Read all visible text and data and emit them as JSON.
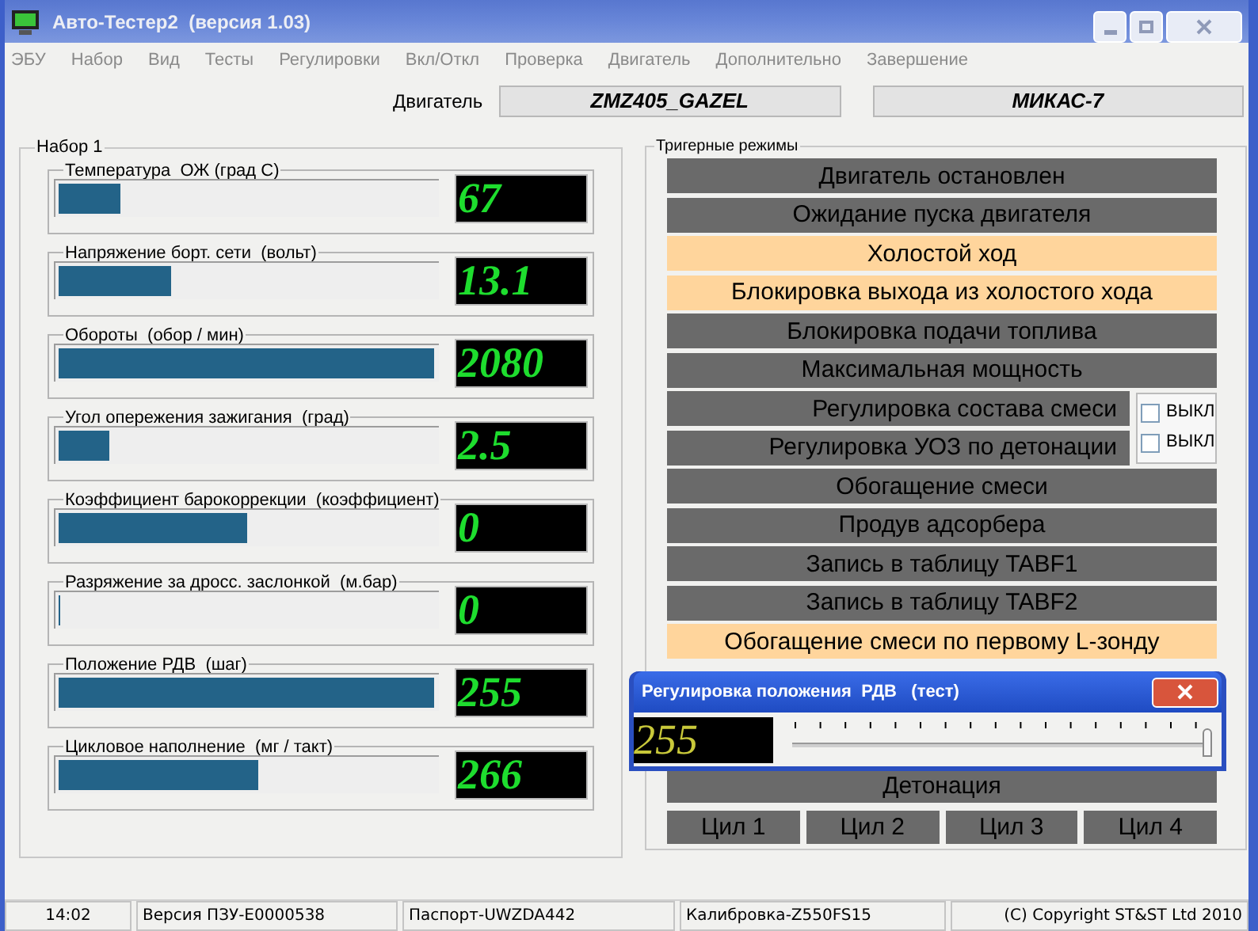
{
  "window": {
    "title": "Авто-Тестер2  (версия 1.03)"
  },
  "menu": [
    {
      "label": "ЭБУ",
      "disabled": true
    },
    {
      "label": "Набор",
      "disabled": true
    },
    {
      "label": "Вид",
      "disabled": true
    },
    {
      "label": "Тесты",
      "disabled": true
    },
    {
      "label": "Регулировки",
      "disabled": true
    },
    {
      "label": "Вкл/Откл",
      "disabled": true
    },
    {
      "label": "Проверка",
      "disabled": true
    },
    {
      "label": "Двигатель",
      "disabled": true
    },
    {
      "label": "Дополнительно",
      "disabled": true
    },
    {
      "label": "Завершение",
      "disabled": true
    }
  ],
  "engine": {
    "label": "Двигатель",
    "fields": [
      "ZMZ405_GAZEL",
      "МИКАС-7"
    ]
  },
  "parameters": {
    "title": "Набор 1",
    "gauges": [
      {
        "label": "Температура  ОЖ (град С)",
        "level": 0.165,
        "value": "67"
      },
      {
        "label": "Напряжение борт. сети  (вольт)",
        "level": 0.3,
        "value": "13.1"
      },
      {
        "label": "Обороты  (обор / мин)",
        "level": 0.995,
        "value": "2080"
      },
      {
        "label": "Угол опережения зажигания  (град)",
        "level": 0.136,
        "value": "2.5"
      },
      {
        "label": "Коэффициент барокоррекции  (коэффициент)",
        "level": 0.5,
        "value": "0"
      },
      {
        "label": "Разряжение за дросс. заслонкой  (м.бар)",
        "level": 0,
        "value": "0"
      },
      {
        "label": "Положение РДВ  (шаг)",
        "level": 0.995,
        "value": "255"
      },
      {
        "label": "Цикловое наполнение  (мг / такт)",
        "level": 0.53,
        "value": "266"
      }
    ]
  },
  "triggers": {
    "title": "Тригерные режимы",
    "modes": [
      {
        "label": "Двигатель остановлен",
        "active": false
      },
      {
        "label": "Ожидание пуска двигателя",
        "active": false
      },
      {
        "label": "Холостой ход",
        "active": true
      },
      {
        "label": "Блокировка выхода из холостого хода",
        "active": true
      },
      {
        "label": "Блокировка подачи топлива",
        "active": false
      },
      {
        "label": "Максимальная мощность",
        "active": false
      },
      {
        "label": "Регулировка состава смеси",
        "active": false,
        "checkbox": {
          "label": "ВЫКЛ",
          "checked": false
        }
      },
      {
        "label": "Регулировка УОЗ по детонации",
        "active": false,
        "checkbox": {
          "label": "ВЫКЛ",
          "checked": false
        }
      },
      {
        "label": "Обогащение смеси",
        "active": false
      },
      {
        "label": "Продув адсорбера",
        "active": false
      },
      {
        "label": "Запись в таблицу TABF1",
        "active": false
      },
      {
        "label": "Запись в таблицу TABF2",
        "active": false
      },
      {
        "label": "Обогащение смеси по первому L-зонду",
        "active": true
      }
    ],
    "lower_modes": [
      {
        "label": "Детонация",
        "active": false
      }
    ],
    "cylinders": [
      {
        "label": "Цил 1",
        "active": false
      },
      {
        "label": "Цил 2",
        "active": false
      },
      {
        "label": "Цил 3",
        "active": false
      },
      {
        "label": "Цил 4",
        "active": false
      }
    ]
  },
  "dialog": {
    "title": "Регулировка положения  РДВ   (тест)",
    "value": "255",
    "slider": {
      "level": 1
    }
  },
  "status_bar": [
    "14:02",
    "Версия ПЗУ-E0000538",
    "Паспорт-UWZDA442",
    "Калибровка-Z550FS15",
    "(C) Copyright ST&ST Ltd 2010"
  ]
}
